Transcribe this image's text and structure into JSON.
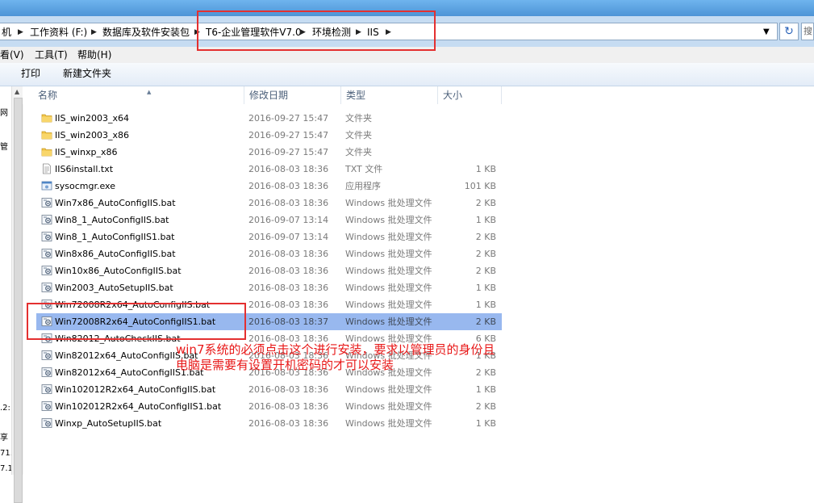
{
  "address": {
    "crumbs": [
      "机",
      "工作资料 (F:)",
      "数据库及软件安装包",
      "T6-企业管理软件V7.0",
      "环境检测",
      "IIS"
    ],
    "search_placeholder": "搜"
  },
  "menu": [
    "看(V)",
    "工具(T)",
    "帮助(H)"
  ],
  "toolbar": {
    "print": "打印",
    "new_folder": "新建文件夹"
  },
  "nav_fragments": [
    "网",
    "管",
    ".2:",
    "享",
    "71.",
    "7.1"
  ],
  "columns": {
    "name": "名称",
    "date": "修改日期",
    "type": "类型",
    "size": "大小"
  },
  "files": [
    {
      "name": "IIS_win2003_x64",
      "date": "2016-09-27 15:47",
      "type": "文件夹",
      "size": "",
      "icon": "folder-icon"
    },
    {
      "name": "IIS_win2003_x86",
      "date": "2016-09-27 15:47",
      "type": "文件夹",
      "size": "",
      "icon": "folder-icon"
    },
    {
      "name": "IIS_winxp_x86",
      "date": "2016-09-27 15:47",
      "type": "文件夹",
      "size": "",
      "icon": "folder-icon"
    },
    {
      "name": "IIS6install.txt",
      "date": "2016-08-03 18:36",
      "type": "TXT 文件",
      "size": "1 KB",
      "icon": "text-file-icon"
    },
    {
      "name": "sysocmgr.exe",
      "date": "2016-08-03 18:36",
      "type": "应用程序",
      "size": "101 KB",
      "icon": "application-icon"
    },
    {
      "name": "Win7x86_AutoConfigIIS.bat",
      "date": "2016-08-03 18:36",
      "type": "Windows 批处理文件",
      "size": "2 KB",
      "icon": "batch-file-icon"
    },
    {
      "name": "Win8_1_AutoConfigIIS.bat",
      "date": "2016-09-07 13:14",
      "type": "Windows 批处理文件",
      "size": "1 KB",
      "icon": "batch-file-icon"
    },
    {
      "name": "Win8_1_AutoConfigIIS1.bat",
      "date": "2016-09-07 13:14",
      "type": "Windows 批处理文件",
      "size": "2 KB",
      "icon": "batch-file-icon"
    },
    {
      "name": "Win8x86_AutoConfigIIS.bat",
      "date": "2016-08-03 18:36",
      "type": "Windows 批处理文件",
      "size": "2 KB",
      "icon": "batch-file-icon"
    },
    {
      "name": "Win10x86_AutoConfigIIS.bat",
      "date": "2016-08-03 18:36",
      "type": "Windows 批处理文件",
      "size": "2 KB",
      "icon": "batch-file-icon"
    },
    {
      "name": "Win2003_AutoSetupIIS.bat",
      "date": "2016-08-03 18:36",
      "type": "Windows 批处理文件",
      "size": "1 KB",
      "icon": "batch-file-icon"
    },
    {
      "name": "Win72008R2x64_AutoConfigIIS.bat",
      "date": "2016-08-03 18:36",
      "type": "Windows 批处理文件",
      "size": "1 KB",
      "icon": "batch-file-icon"
    },
    {
      "name": "Win72008R2x64_AutoConfigIIS1.bat",
      "date": "2016-08-03 18:37",
      "type": "Windows 批处理文件",
      "size": "2 KB",
      "icon": "batch-file-icon",
      "selected": true
    },
    {
      "name": "Win82012_AutoCheckIIS.bat",
      "date": "2016-08-03 18:36",
      "type": "Windows 批处理文件",
      "size": "6 KB",
      "icon": "batch-file-icon"
    },
    {
      "name": "Win82012x64_AutoConfigIIS.bat",
      "date": "2016-08-03 18:36",
      "type": "Windows 批处理文件",
      "size": "1 KB",
      "icon": "batch-file-icon"
    },
    {
      "name": "Win82012x64_AutoConfigIIS1.bat",
      "date": "2016-08-03 18:36",
      "type": "Windows 批处理文件",
      "size": "2 KB",
      "icon": "batch-file-icon"
    },
    {
      "name": "Win102012R2x64_AutoConfigIIS.bat",
      "date": "2016-08-03 18:36",
      "type": "Windows 批处理文件",
      "size": "1 KB",
      "icon": "batch-file-icon"
    },
    {
      "name": "Win102012R2x64_AutoConfigIIS1.bat",
      "date": "2016-08-03 18:36",
      "type": "Windows 批处理文件",
      "size": "2 KB",
      "icon": "batch-file-icon"
    },
    {
      "name": "Winxp_AutoSetupIIS.bat",
      "date": "2016-08-03 18:36",
      "type": "Windows 批处理文件",
      "size": "1 KB",
      "icon": "batch-file-icon"
    }
  ],
  "annotation": {
    "text": "win7系统的必须点击这个进行安装，要求以管理员的身份且电脑是需要有设置开机密码的才可以安装",
    "color": "#e81818"
  },
  "colors": {
    "selection": "#98b8ef",
    "annotation_box": "#e43030",
    "address_bar": "#c6dcf2"
  }
}
